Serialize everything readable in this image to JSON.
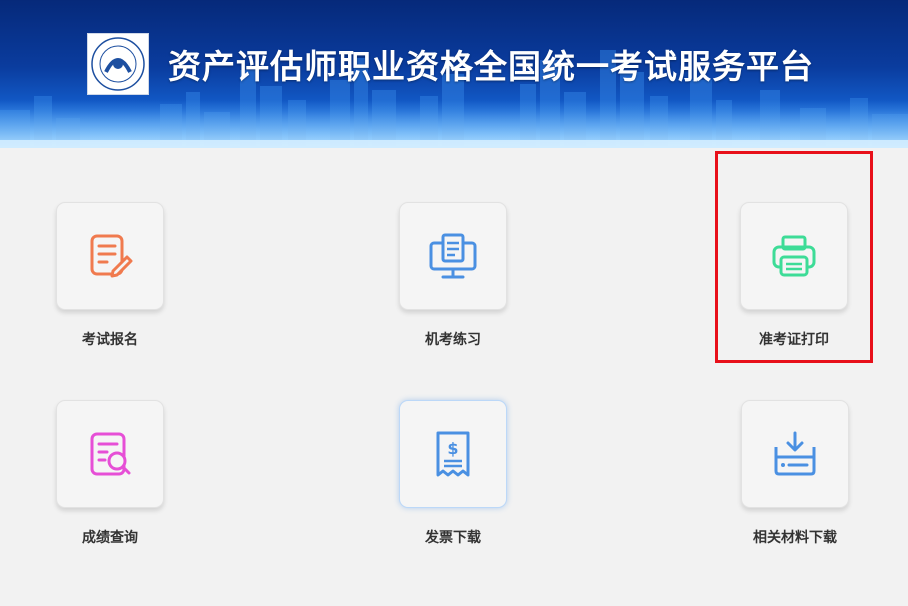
{
  "header": {
    "title": "资产评估师职业资格全国统一考试服务平台",
    "logo_icon": "caas-association-logo",
    "colors": {
      "banner_top": "#06297a",
      "banner_bottom": "#4aa6ff"
    }
  },
  "tiles": [
    {
      "label": "考试报名",
      "icon": "edit-document-icon",
      "color": "#f07a4e"
    },
    {
      "label": "机考练习",
      "icon": "computer-document-icon",
      "color": "#4a90e2"
    },
    {
      "label": "准考证打印",
      "icon": "printer-icon",
      "color": "#3ddc97"
    },
    {
      "label": "成绩查询",
      "icon": "document-search-icon",
      "color": "#e64fd6"
    },
    {
      "label": "发票下载",
      "icon": "receipt-dollar-icon",
      "color": "#4a90e2"
    },
    {
      "label": "相关材料下载",
      "icon": "download-tray-icon",
      "color": "#4a90e2"
    }
  ],
  "highlight_color": "#e8101a"
}
